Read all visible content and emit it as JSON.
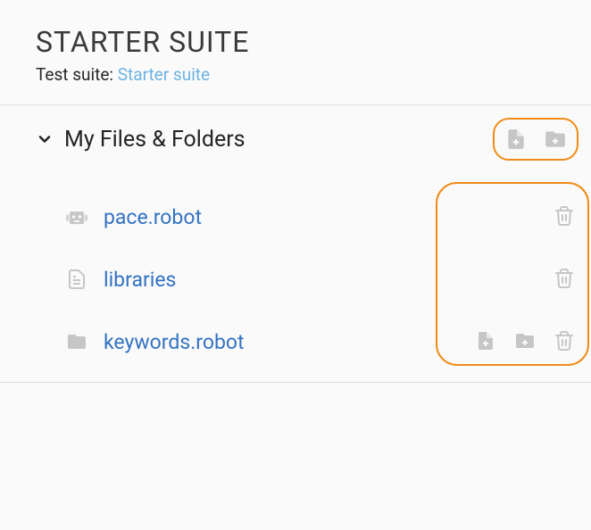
{
  "header": {
    "title": "STARTER SUITE",
    "sub_label": "Test suite: ",
    "sub_link": "Starter suite"
  },
  "section": {
    "title": "My Files & Folders"
  },
  "files": [
    {
      "name": "pace.robot",
      "icon": "robot",
      "actions": [
        "trash"
      ]
    },
    {
      "name": "libraries",
      "icon": "file-text",
      "actions": [
        "trash"
      ]
    },
    {
      "name": "keywords.robot",
      "icon": "folder",
      "actions": [
        "new-file",
        "new-folder",
        "trash"
      ]
    }
  ]
}
